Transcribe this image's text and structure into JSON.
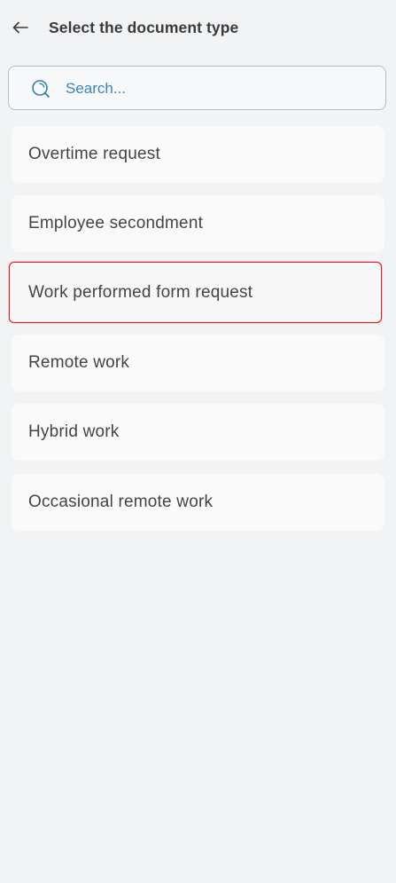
{
  "header": {
    "back_icon": "arrow-left-icon",
    "title": "Select the document type"
  },
  "search": {
    "icon": "search-icon",
    "placeholder": "Search...",
    "value": ""
  },
  "colors": {
    "background": "#f2f3f5",
    "card": "#fafafa",
    "accent": "#2d7fb0",
    "highlight_border": "#e02020"
  },
  "document_types": [
    {
      "label": "Overtime request",
      "highlighted": false
    },
    {
      "label": "Employee secondment",
      "highlighted": false
    },
    {
      "label": "Work performed form request",
      "highlighted": true
    },
    {
      "label": "Remote work",
      "highlighted": false
    },
    {
      "label": "Hybrid work",
      "highlighted": false
    },
    {
      "label": "Occasional remote work",
      "highlighted": false
    }
  ]
}
